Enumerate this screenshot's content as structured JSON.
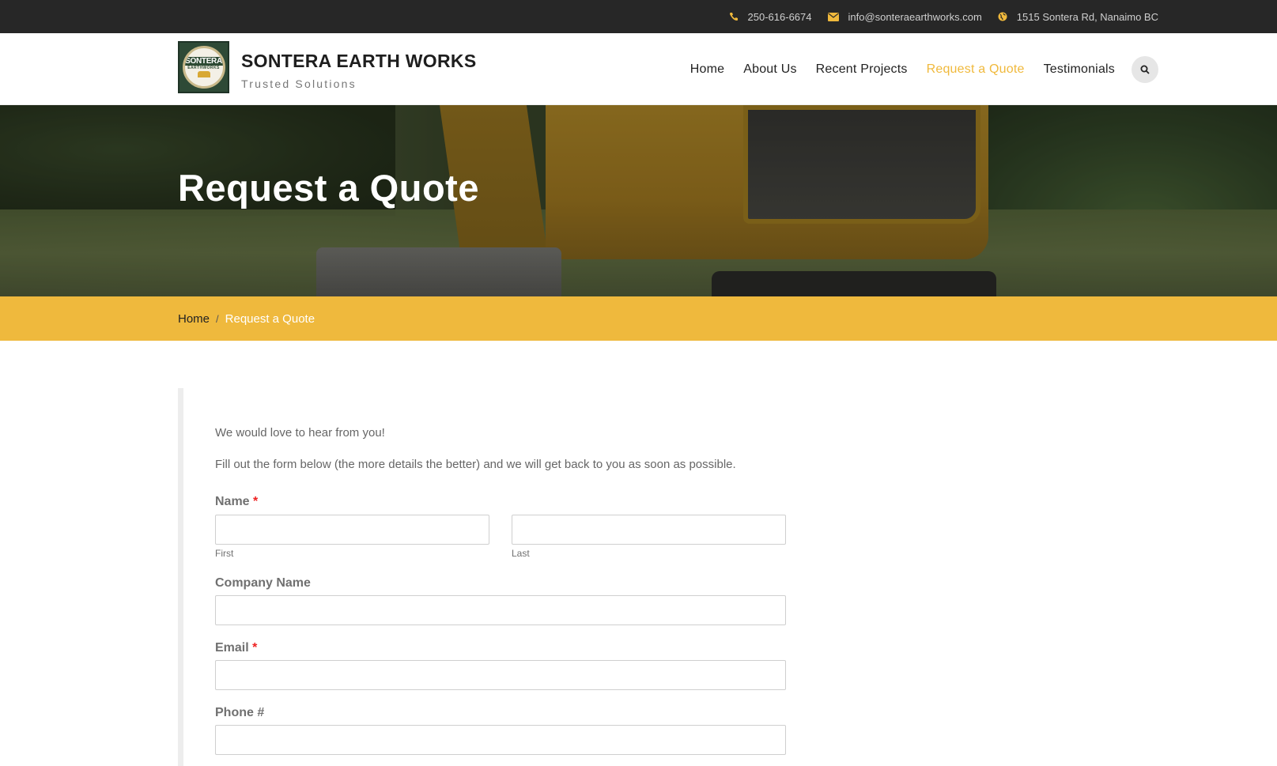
{
  "topbar": {
    "phone": "250-616-6674",
    "email": "info@sonteraearthworks.com",
    "address": "1515 Sontera Rd, Nanaimo BC",
    "icon_color": "#f0b93c"
  },
  "brand": {
    "logo_text": "SONTERA",
    "logo_sub": "EARTHWORKS",
    "name": "SONTERA EARTH WORKS",
    "tagline": "Trusted Solutions"
  },
  "nav": {
    "items": [
      "Home",
      "About Us",
      "Recent Projects",
      "Request a Quote",
      "Testimonials"
    ],
    "active": "Request a Quote",
    "accent": "#f0b93c"
  },
  "hero": {
    "title": "Request a Quote"
  },
  "breadcrumb": {
    "home": "Home",
    "separator": "/",
    "current": "Request a Quote",
    "bar_color": "#efb93d"
  },
  "content": {
    "intro_line1": "We would love to hear from you!",
    "intro_line2": "Fill out the form below (the more details the better) and we will get back to you as soon as possible."
  },
  "form": {
    "name_label": "Name",
    "required_mark": "*",
    "first_sublabel": "First",
    "last_sublabel": "Last",
    "company_label": "Company Name",
    "email_label": "Email",
    "phone_label": "Phone #",
    "first_value": "",
    "last_value": "",
    "company_value": "",
    "email_value": "",
    "phone_value": ""
  }
}
